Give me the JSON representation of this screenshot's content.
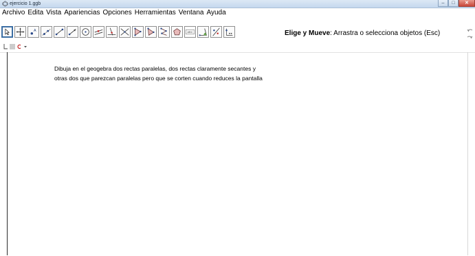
{
  "window": {
    "title": "ejercicio 1.ggb",
    "minimize_symbol": "–",
    "maximize_symbol": "□",
    "close_symbol": "✕"
  },
  "menu": [
    "Archivo",
    "Edita",
    "Vista",
    "Apariencias",
    "Opciones",
    "Herramientas",
    "Ventana",
    "Ayuda"
  ],
  "toolbar": {
    "tools": [
      "move",
      "move-graphics-view",
      "point",
      "line-through-two-points",
      "segment",
      "circle-center-point",
      "perpendicular-line",
      "angle-bisector",
      "intersect",
      "polygon",
      "regular-polygon",
      "polyline",
      "rigid-polygon",
      "text",
      "angle",
      "reflect-about-line",
      "slider"
    ],
    "selected_tool": "move",
    "tool_name": "Elige y Mueve",
    "tool_help": ": Arrastra o selecciona objetos (Esc)",
    "text_tool_label": "ABC"
  },
  "graphics": {
    "instruction_line1": "Dibuja en el geogebra dos rectas paralelas, dos rectas claramente secantes y",
    "instruction_line2": "otras dos que parezcan paralelas pero que se corten cuando reduces la pantalla"
  }
}
